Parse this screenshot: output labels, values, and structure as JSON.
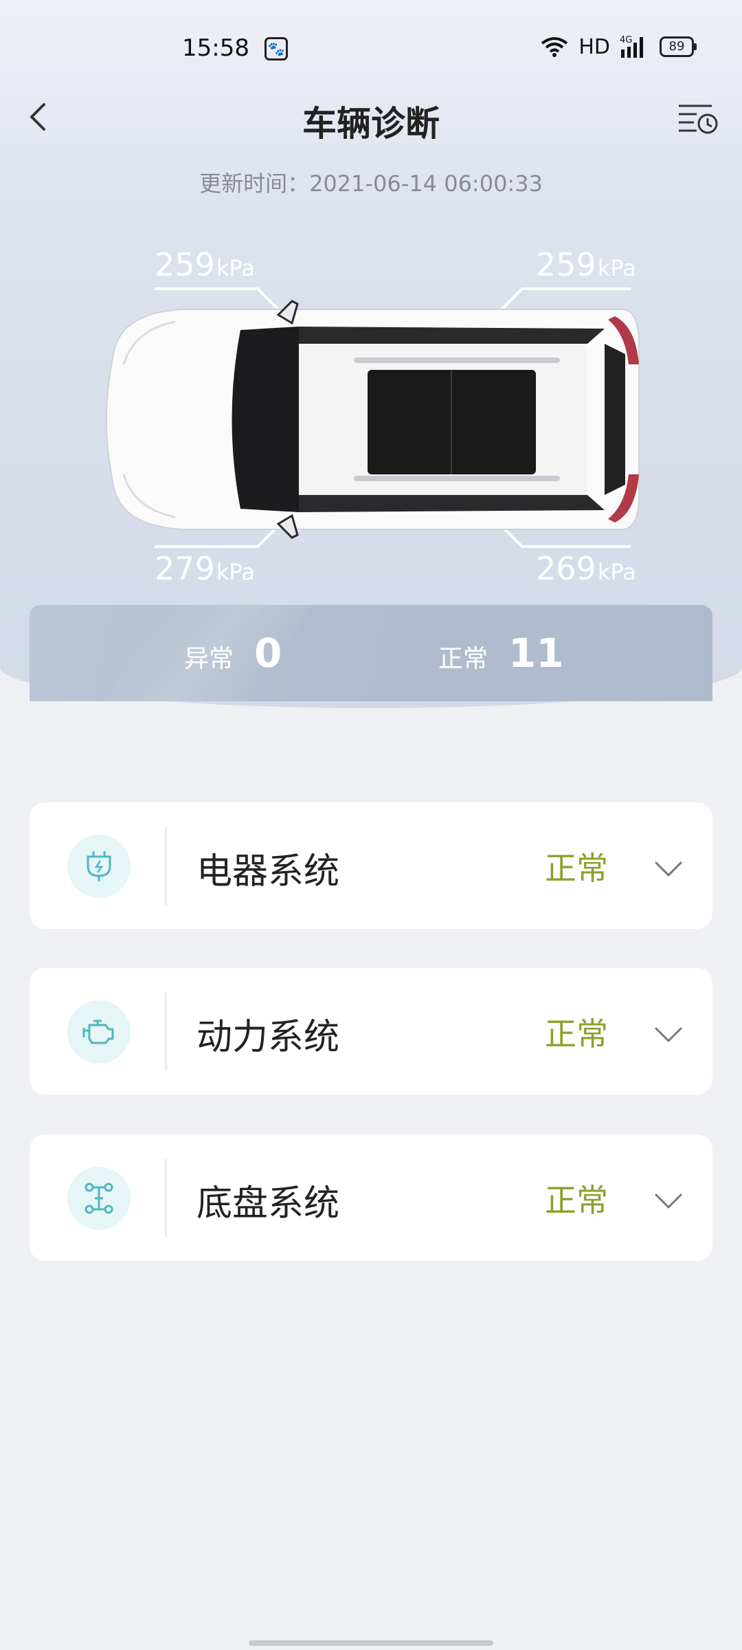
{
  "status_bar": {
    "time": "15:58",
    "app_icon": "paw-icon",
    "network": "HD",
    "signal": "4G",
    "battery": "89"
  },
  "header": {
    "title": "车辆诊断",
    "update_time": "更新时间：2021-06-14 06:00:33"
  },
  "tires": {
    "front_left": "259",
    "front_right": "259",
    "rear_left": "279",
    "rear_right": "269",
    "unit": "kPa"
  },
  "summary": {
    "abnormal_label": "异常",
    "abnormal_count": "0",
    "normal_label": "正常",
    "normal_count": "11"
  },
  "systems": [
    {
      "label": "电器系统",
      "status": "正常",
      "icon": "electric-plug-icon"
    },
    {
      "label": "动力系统",
      "status": "正常",
      "icon": "engine-icon"
    },
    {
      "label": "底盘系统",
      "status": "正常",
      "icon": "chassis-icon"
    }
  ],
  "colors": {
    "status_ok": "#8aa12c",
    "icon_teal": "#4fb6c0",
    "summary_bar": "#b1bdce"
  }
}
